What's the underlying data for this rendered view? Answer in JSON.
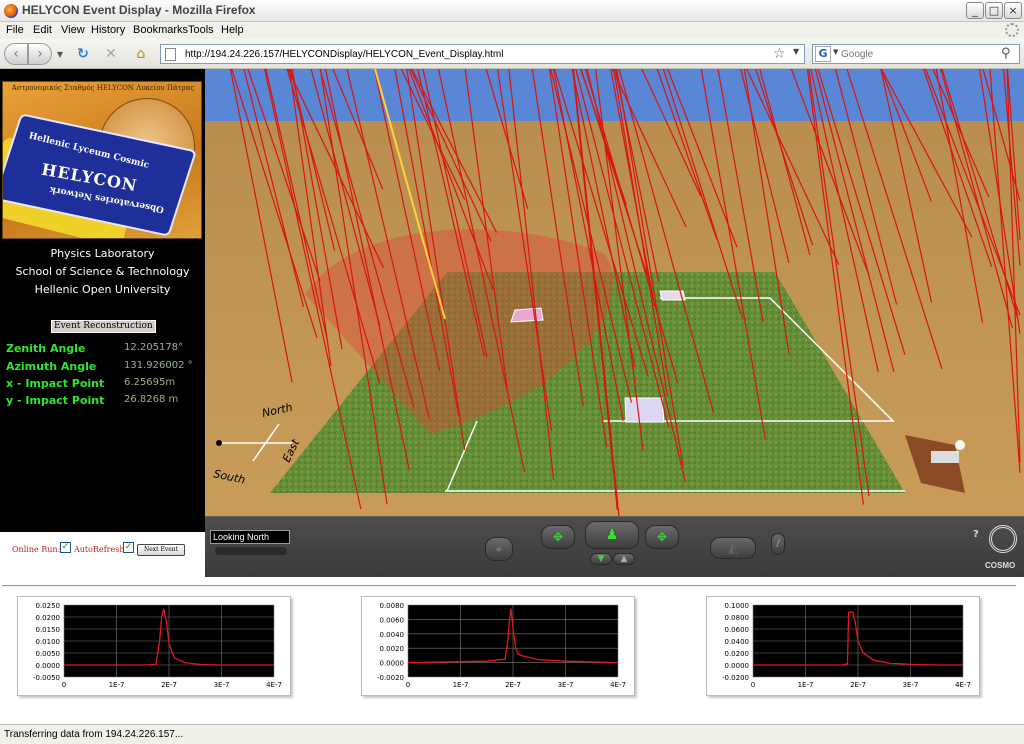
{
  "window": {
    "title": "HELYCON Event Display - Mozilla Firefox",
    "minimize": "_",
    "maximize": "□",
    "close": "×"
  },
  "menu": [
    "File",
    "Edit",
    "View",
    "History",
    "Bookmarks",
    "Tools",
    "Help"
  ],
  "nav": {
    "url": "http://194.24.226.157/HELYCONDisplay/HELYCON_Event_Display.html",
    "search_engine": "G",
    "search_placeholder": "Google"
  },
  "logo": {
    "top_text": "Αστρονομικός Σταθμός HELYCON Λυκείου Πάτρας",
    "flag_text": "HELYCON",
    "flag_sub": "Hellenic Lyceum Cosmic",
    "flag_sub2": "Observatories Network"
  },
  "institution": [
    "Physics Laboratory",
    "School of Science & Technology",
    "Hellenic Open University"
  ],
  "reconstruction": {
    "title": "Event Reconstruction",
    "params": [
      {
        "label": "Zenith Angle",
        "value": "12.205178°"
      },
      {
        "label": "Azimuth Angle",
        "value": "131.926002 °"
      },
      {
        "label": "x - Impact Point",
        "value": "6.25695m"
      },
      {
        "label": "y - Impact Point",
        "value": "26.8268 m"
      }
    ]
  },
  "controls": {
    "online_run_label": "Online Run:",
    "autorefresh_label": "AutoRefresh:",
    "online_checked": true,
    "autorefresh_checked": true,
    "check_mark": "✓",
    "next_event_label": "Next Event"
  },
  "scene": {
    "compass": {
      "north": "North",
      "south": "South",
      "east": "East"
    }
  },
  "cosmo": {
    "viewpoint": "Looking North",
    "help": "?",
    "brand": "COSMO"
  },
  "chart_data": [
    {
      "type": "line",
      "ylim": [
        -0.005,
        0.025
      ],
      "ytick_labels": [
        "0.0250",
        "0.0200",
        "0.0150",
        "0.0100",
        "0.0050",
        "0.0000",
        "-0.0050"
      ],
      "xlim": [
        0,
        4e-07
      ],
      "xtick_labels": [
        "0",
        "1E-7",
        "2E-7",
        "3E-7",
        "4E-7"
      ],
      "series": [
        {
          "color": "#e01a1a",
          "x": [
            0,
            1.5e-07,
            1.75e-07,
            1.82e-07,
            1.86e-07,
            1.9e-07,
            1.95e-07,
            2e-07,
            2.1e-07,
            2.3e-07,
            2.6e-07,
            3e-07,
            3.5e-07,
            4e-07
          ],
          "y": [
            0.0,
            0.0,
            0.0002,
            0.01,
            0.02,
            0.0235,
            0.018,
            0.009,
            0.003,
            0.001,
            0.0002,
            0.0,
            0.0,
            0.0
          ]
        }
      ]
    },
    {
      "type": "line",
      "ylim": [
        -0.002,
        0.008
      ],
      "ytick_labels": [
        "0.0080",
        "0.0060",
        "0.0040",
        "0.0020",
        "0.0000",
        "-0.0020"
      ],
      "xlim": [
        0,
        4e-07
      ],
      "xtick_labels": [
        "0",
        "1E-7",
        "2E-7",
        "3E-7",
        "4E-7"
      ],
      "series": [
        {
          "color": "#e01a1a",
          "x": [
            0,
            1.5e-07,
            1.85e-07,
            1.9e-07,
            1.93e-07,
            1.96e-07,
            2e-07,
            2.05e-07,
            2.1e-07,
            2.2e-07,
            2.5e-07,
            3e-07,
            4e-07
          ],
          "y": [
            0.0,
            0.0002,
            0.0005,
            0.003,
            0.0057,
            0.0075,
            0.0048,
            0.002,
            0.0012,
            0.0009,
            0.0004,
            0.0002,
            0.0
          ]
        }
      ]
    },
    {
      "type": "line",
      "ylim": [
        -0.02,
        0.1
      ],
      "ytick_labels": [
        "0.1000",
        "0.0800",
        "0.0600",
        "0.0400",
        "0.0200",
        "0.0000",
        "-0.0200"
      ],
      "xlim": [
        0,
        4e-07
      ],
      "xtick_labels": [
        "0",
        "1E-7",
        "2E-7",
        "3E-7",
        "4E-7"
      ],
      "series": [
        {
          "color": "#e01a1a",
          "x": [
            0,
            1.7e-07,
            1.8e-07,
            1.82e-07,
            1.9e-07,
            1.95e-07,
            2e-07,
            2.1e-07,
            2.3e-07,
            2.6e-07,
            3e-07,
            3.5e-07,
            4e-07
          ],
          "y": [
            0.0,
            0.0,
            0.002,
            0.088,
            0.088,
            0.07,
            0.04,
            0.02,
            0.008,
            0.003,
            0.001,
            0.0,
            0.0
          ]
        }
      ]
    }
  ],
  "status": "Transferring data from 194.24.226.157..."
}
